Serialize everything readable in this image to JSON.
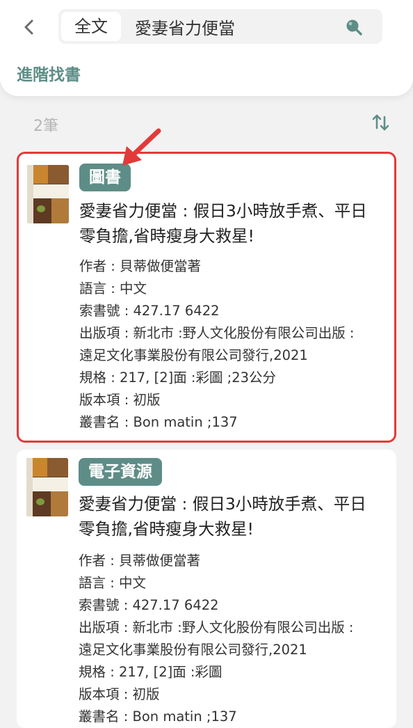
{
  "header": {
    "search": {
      "scope_label": "全文",
      "query": "愛妻省力便當"
    },
    "advanced_search_label": "進階找書"
  },
  "results": {
    "count_label": "2筆",
    "items": [
      {
        "type_badge": "圖書",
        "title_line1": "愛妻省力便當 : 假日3小時放手煮、平日",
        "title_line2": "零負擔,省時瘦身大救星!",
        "meta": [
          "作者 : 貝蒂做便當著",
          "語言 : 中文",
          "索書號 : 427.17 6422",
          "出版項 : 新北市 :野人文化股份有限公司出版 :",
          "遠足文化事業股份有限公司發行,2021",
          "規格 : 217, [2]面 :彩圖 ;23公分",
          "版本項 : 初版",
          "叢書名 : Bon matin ;137"
        ]
      },
      {
        "type_badge": "電子資源",
        "title_line1": "愛妻省力便當 : 假日3小時放手煮、平日",
        "title_line2": "零負擔,省時瘦身大救星!",
        "meta": [
          "作者 : 貝蒂做便當著",
          "語言 : 中文",
          "索書號 : 427.17 6422",
          "出版項 : 新北市 :野人文化股份有限公司出版 :",
          "遠足文化事業股份有限公司發行,2021",
          "規格 : 217, [2]面 :彩圖",
          "版本項 : 初版",
          "叢書名 : Bon matin ;137"
        ]
      }
    ]
  },
  "icons": {
    "back": "chevron-left-icon",
    "search": "search-icon",
    "sort": "sort-arrows-icon",
    "annotation": "red-arrow-icon"
  },
  "colors": {
    "accent": "#5e8d87",
    "highlight_border": "#e23a3a",
    "background": "#f2f2f2"
  }
}
